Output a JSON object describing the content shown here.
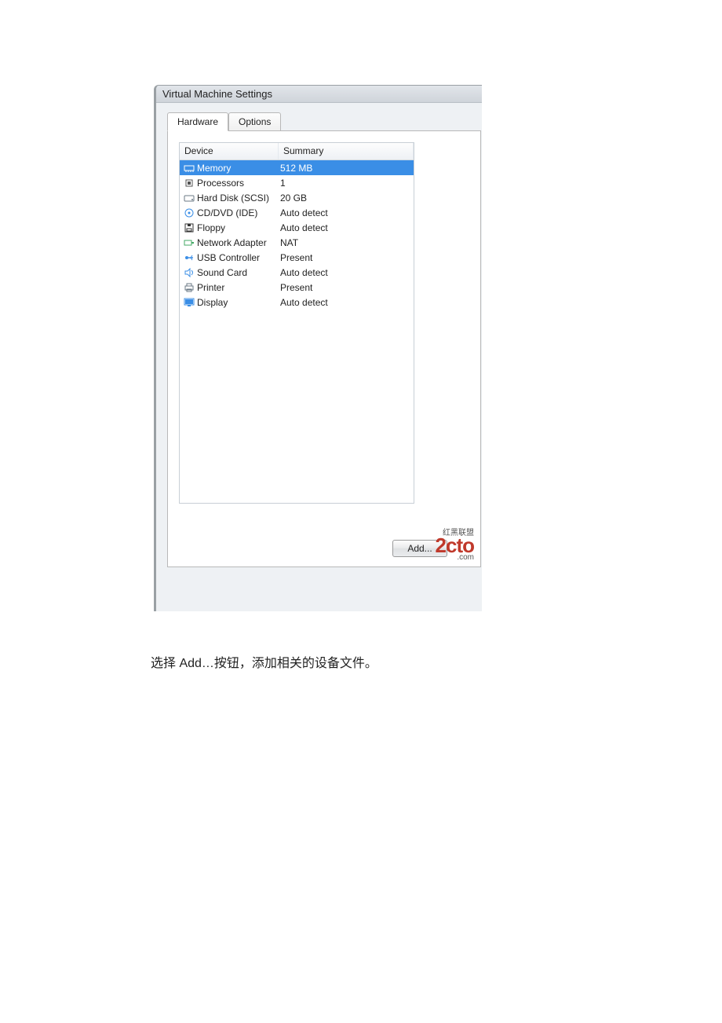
{
  "window": {
    "title": "Virtual Machine Settings"
  },
  "tabs": {
    "hardware": "Hardware",
    "options": "Options"
  },
  "list": {
    "header": {
      "device": "Device",
      "summary": "Summary"
    },
    "rows": [
      {
        "icon": "memory",
        "label": "Memory",
        "summary": "512 MB",
        "selected": true
      },
      {
        "icon": "cpu",
        "label": "Processors",
        "summary": "1"
      },
      {
        "icon": "hdd",
        "label": "Hard Disk (SCSI)",
        "summary": "20 GB"
      },
      {
        "icon": "cd",
        "label": "CD/DVD (IDE)",
        "summary": "Auto detect"
      },
      {
        "icon": "floppy",
        "label": "Floppy",
        "summary": "Auto detect"
      },
      {
        "icon": "nic",
        "label": "Network Adapter",
        "summary": "NAT"
      },
      {
        "icon": "usb",
        "label": "USB Controller",
        "summary": "Present"
      },
      {
        "icon": "sound",
        "label": "Sound Card",
        "summary": "Auto detect"
      },
      {
        "icon": "printer",
        "label": "Printer",
        "summary": "Present"
      },
      {
        "icon": "display",
        "label": "Display",
        "summary": "Auto detect"
      }
    ]
  },
  "buttons": {
    "add": "Add..."
  },
  "watermark": {
    "big": "2cto",
    "small_top": "红黑联盟",
    "small_bot": ".com"
  },
  "caption": "选择 Add…按钮，添加相关的设备文件。",
  "icons": {
    "memory": "#4aa3df",
    "cpu": "#555",
    "hdd": "#6b7a86",
    "cd": "#3a8ee6",
    "floppy": "#333",
    "nic": "#4a6",
    "usb": "#3a8ee6",
    "sound": "#3a8ee6",
    "printer": "#6b7a86",
    "display": "#3a8ee6"
  }
}
